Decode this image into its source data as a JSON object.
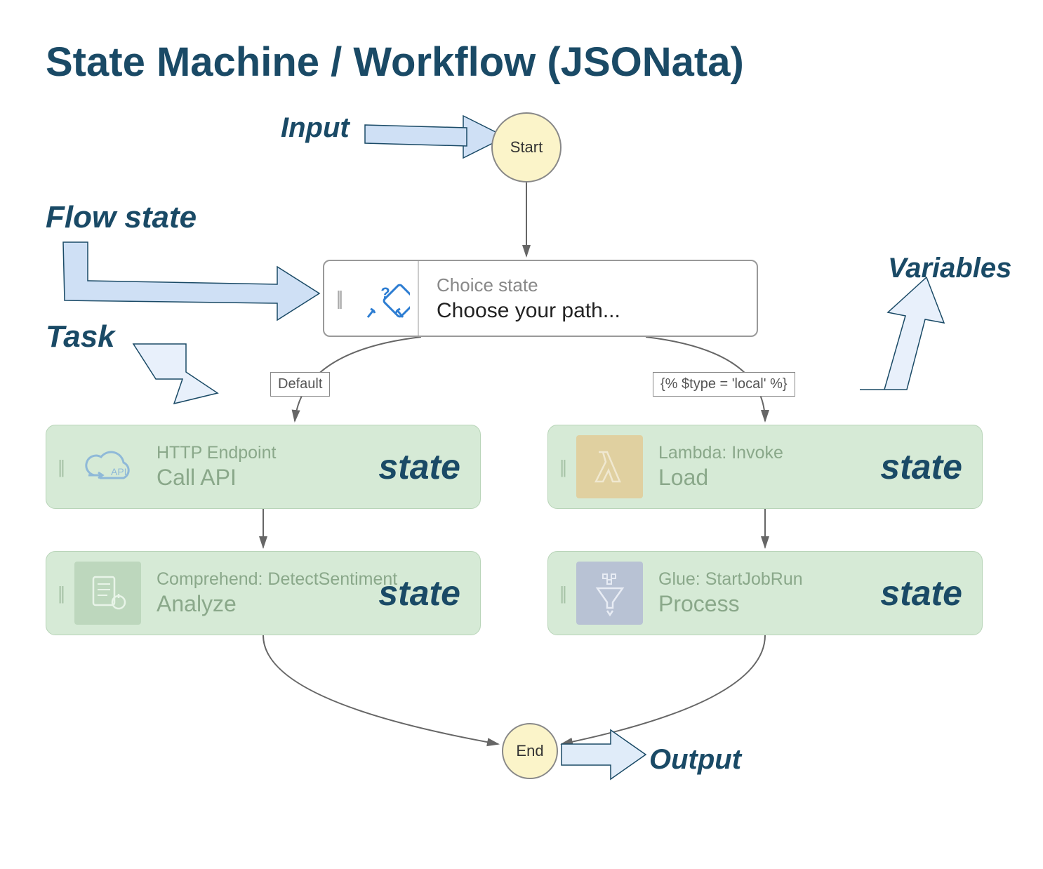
{
  "title": "State Machine / Workflow (JSONata)",
  "annotations": {
    "input": "Input",
    "flow_state": "Flow state",
    "task": "Task",
    "variables": "Variables",
    "output": "Output"
  },
  "nodes": {
    "start": "Start",
    "end": "End",
    "choice": {
      "type_label": "Choice state",
      "name": "Choose your path..."
    }
  },
  "branch_labels": {
    "default": "Default",
    "condition": "{% $type = 'local' %}"
  },
  "states": {
    "call_api": {
      "type_label": "HTTP Endpoint",
      "name": "Call API",
      "badge": "state"
    },
    "analyze": {
      "type_label": "Comprehend: DetectSentiment",
      "name": "Analyze",
      "badge": "state"
    },
    "load": {
      "type_label": "Lambda: Invoke",
      "name": "Load",
      "badge": "state"
    },
    "process": {
      "type_label": "Glue: StartJobRun",
      "name": "Process",
      "badge": "state"
    }
  },
  "colors": {
    "heading": "#1a4a66",
    "state_bg": "#d6ead6",
    "start_fill": "#fbf4c9"
  }
}
